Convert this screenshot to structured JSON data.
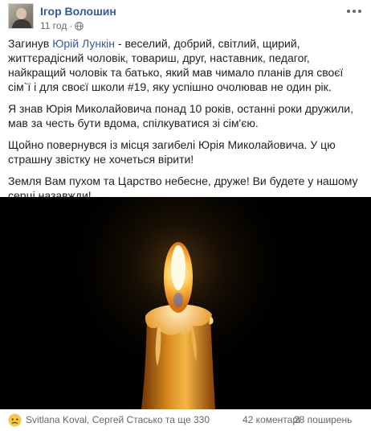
{
  "post": {
    "author": "Ігор Волошин",
    "time": "11 год",
    "separator": "·",
    "privacy_icon": "globe-icon",
    "more_icon": "more-options-icon",
    "paragraphs": [
      {
        "before": "Загинув ",
        "mention": "Юрій Лункін",
        "after": " - веселий, добрий, світлий, щирий, життєрадісний чоловік, товариш, друг, наставник, педагог, найкращий чоловік та батько, який мав чимало планів для своєї сім`ї і для своєї школи #19, яку успішно очолював не один рік."
      },
      {
        "text": "Я знав Юрія Миколайовича понад 10 років, останні роки дружили, мав за честь бути вдома, спілкуватися зі сім'єю."
      },
      {
        "text": "Щойно повернувся із місця загибелі Юрія Миколайовича. У цю страшну звістку не хочеться вірити!"
      },
      {
        "text": "Земля Вам пухом та Царство небесне, друже! Ви будете у нашому серці назавжди!"
      }
    ],
    "image": "candle-flame-photo"
  },
  "footer": {
    "reaction_icon": "sad-reaction-icon",
    "reactors": "Svitlana Koval, Сергей Стасько та ще 330",
    "comments": "42 коментарі",
    "shares": "28 поширень"
  }
}
